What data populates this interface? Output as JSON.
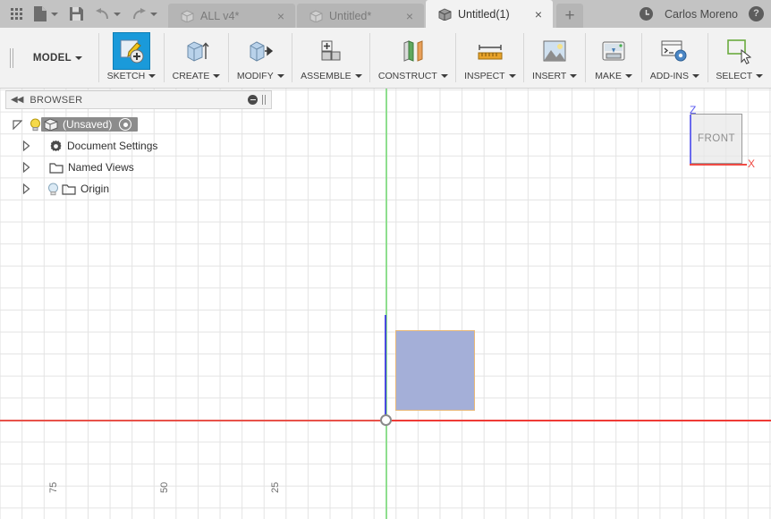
{
  "titlebar": {
    "apps_icon": "grid-apps-icon",
    "file_icon": "new-file-icon",
    "save_icon": "save-icon",
    "undo_icon": "undo-icon",
    "redo_icon": "redo-icon",
    "tabs": [
      {
        "label": "ALL v4*",
        "icon": "cube-icon",
        "close": "×",
        "active": false
      },
      {
        "label": "Untitled*",
        "icon": "cube-icon",
        "close": "×",
        "active": false
      },
      {
        "label": "Untitled(1)",
        "icon": "cube-icon",
        "close": "×",
        "active": true
      }
    ],
    "new_tab_label": "+",
    "clock_icon": "clock-icon",
    "user_name": "Carlos Moreno",
    "help_label": "?"
  },
  "ribbon": {
    "workspace_label": "MODEL",
    "groups": [
      {
        "label": "SKETCH",
        "icon": "sketch-create-icon",
        "active": true
      },
      {
        "label": "CREATE",
        "icon": "extrude-icon",
        "active": false
      },
      {
        "label": "MODIFY",
        "icon": "press-pull-icon",
        "active": false
      },
      {
        "label": "ASSEMBLE",
        "icon": "new-component-icon",
        "active": false
      },
      {
        "label": "CONSTRUCT",
        "icon": "offset-plane-icon",
        "active": false
      },
      {
        "label": "INSPECT",
        "icon": "measure-ruler-icon",
        "active": false
      },
      {
        "label": "INSERT",
        "icon": "insert-image-icon",
        "active": false
      },
      {
        "label": "MAKE",
        "icon": "3d-print-icon",
        "active": false
      },
      {
        "label": "ADD-INS",
        "icon": "script-gear-icon",
        "active": false
      },
      {
        "label": "SELECT",
        "icon": "select-cursor-icon",
        "active": false
      }
    ]
  },
  "browser": {
    "collapse_icon": "collapse-left-icon",
    "title": "BROWSER",
    "minimize_icon": "minimize-icon",
    "resize_grip_icon": "resize-grip-icon",
    "nodes": [
      {
        "label": "(Unsaved)",
        "icon": "cube-icon",
        "bulb": true,
        "selected": true,
        "indent": 0
      },
      {
        "label": "Document Settings",
        "icon": "gear-icon",
        "bulb": false,
        "selected": false,
        "indent": 1
      },
      {
        "label": "Named Views",
        "icon": "folder-icon",
        "bulb": false,
        "selected": false,
        "indent": 1
      },
      {
        "label": "Origin",
        "icon": "folder-icon",
        "bulb": true,
        "selected": false,
        "indent": 1
      }
    ]
  },
  "viewcube": {
    "face_label": "FRONT",
    "z_label": "Z",
    "x_label": "X"
  },
  "canvas": {
    "ruler_labels": [
      "75",
      "50",
      "25"
    ],
    "origin_marker": "origin-point",
    "sketch_profile": "rectangle-profile"
  },
  "colors": {
    "accent_blue": "#1a9ada",
    "axis_red": "#ef3b36",
    "axis_green": "#8ede8e",
    "axis_blue": "#4b4be0",
    "profile_fill": "#a4afd8",
    "profile_stroke": "#e8b878",
    "titlebar_bg": "#c3c3c3",
    "ribbon_bg": "#f2f2f2",
    "selection_gray": "#8c8c8c"
  }
}
